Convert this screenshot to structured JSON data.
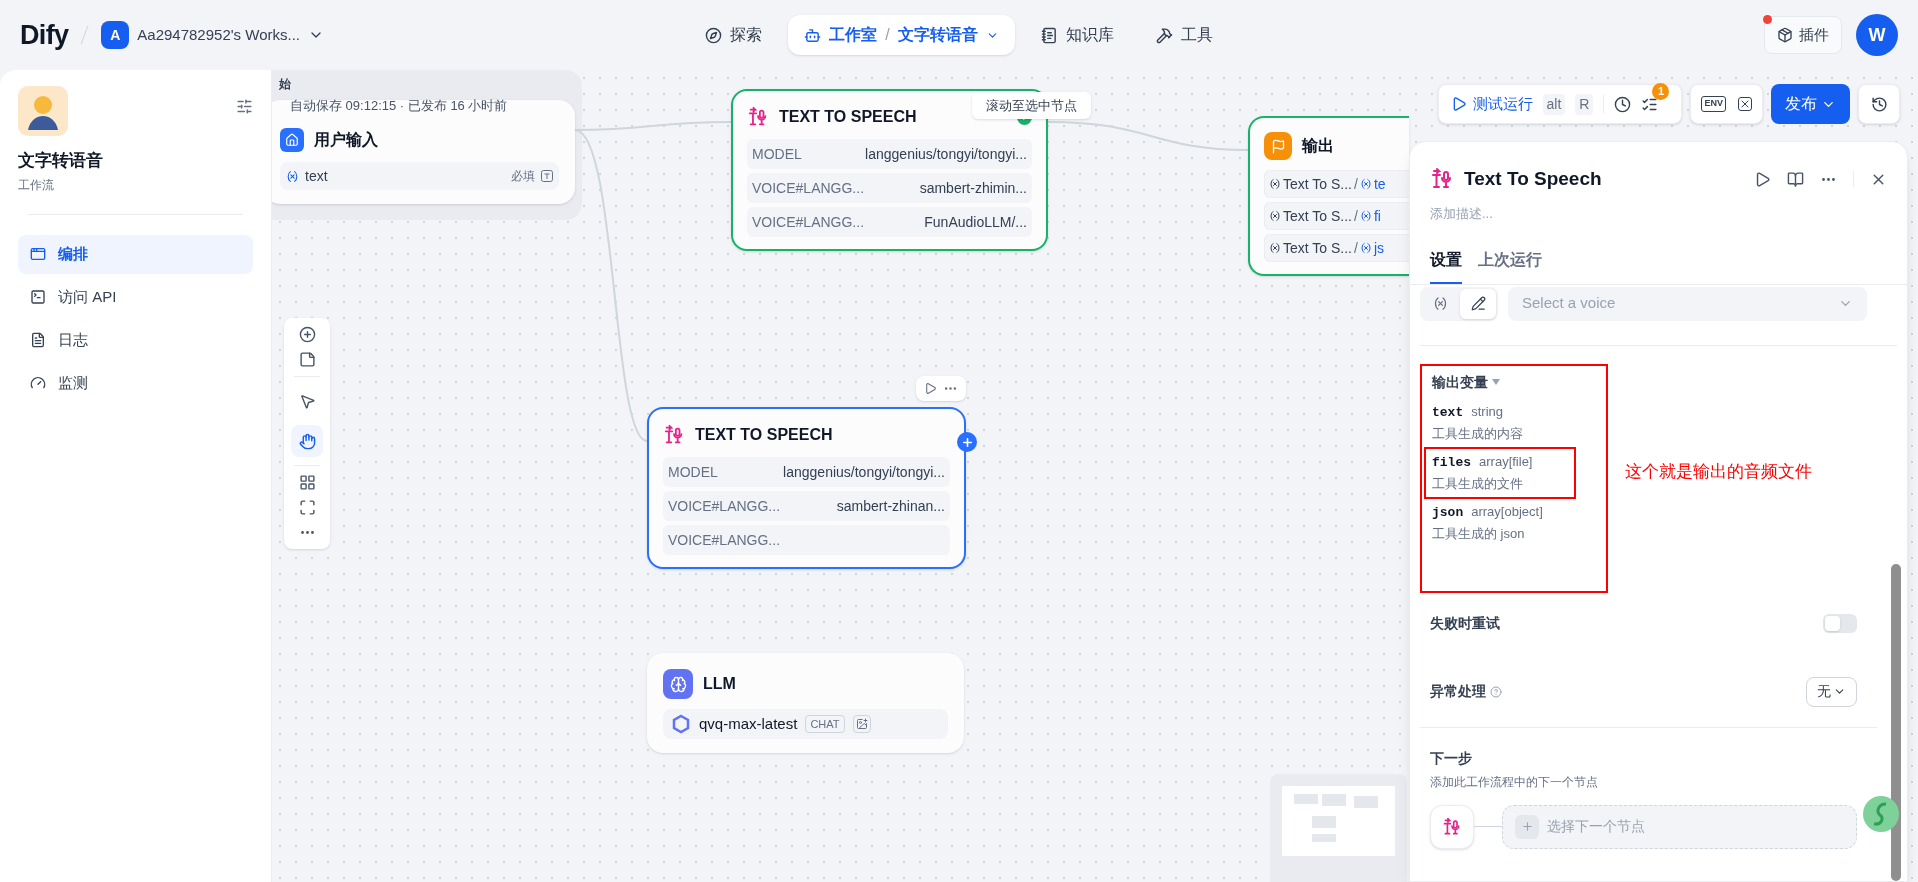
{
  "header": {
    "logo": "Dify",
    "workspace": {
      "initial": "A",
      "name": "Aa294782952's Works..."
    },
    "nav": [
      {
        "kind": "explore",
        "label": "探索",
        "selected": false
      },
      {
        "kind": "studio",
        "label": "工作室",
        "separator": "/",
        "app": "文字转语音",
        "selected": true
      },
      {
        "kind": "knowledge",
        "label": "知识库",
        "selected": false
      },
      {
        "kind": "tools",
        "label": "工具",
        "selected": false
      }
    ],
    "plugins": "插件",
    "avatar": "W"
  },
  "sidebar": {
    "app_name": "文字转语音",
    "app_type": "工作流",
    "items": [
      {
        "kind": "orchestrate",
        "label": "编排",
        "selected": true
      },
      {
        "kind": "api",
        "label": "访问 API",
        "selected": false
      },
      {
        "kind": "logs",
        "label": "日志",
        "selected": false
      },
      {
        "kind": "monitor",
        "label": "监测",
        "selected": false
      }
    ]
  },
  "canvas": {
    "autosave": "自动保存 09:12:15 · 已发布 16 小时前",
    "tooltip": "滚动至选中节点",
    "tools": [
      {
        "kind": "pointer",
        "selected": false
      },
      {
        "kind": "hand",
        "selected": true
      }
    ],
    "toolbar": {
      "test_run": "测试运行",
      "shortcut": [
        "alt",
        "R"
      ],
      "checklist_badge": "1",
      "env": "ENV",
      "publish": "发布"
    },
    "nodes": [
      {
        "kind": "start",
        "header": "始",
        "title": "用户输入",
        "selected": false,
        "succeeded": false,
        "variables": [
          {
            "name": "text",
            "required": "必填"
          }
        ]
      },
      {
        "kind": "tts",
        "title": "TEXT TO SPEECH",
        "selected": false,
        "succeeded": true,
        "rows": [
          {
            "label": "MODEL",
            "value": "langgenius/tongyi/tongyi..."
          },
          {
            "label": "VOICE#LANGG...",
            "value": "sambert-zhimin..."
          },
          {
            "label": "VOICE#LANGG...",
            "value": "FunAudioLLM/..."
          }
        ]
      },
      {
        "kind": "end",
        "title": "输出",
        "selected": false,
        "succeeded": true,
        "rows": [
          {
            "label": "Text To S...",
            "separator": "/",
            "value": "te"
          },
          {
            "label": "Text To S...",
            "separator": "/",
            "value": "fi"
          },
          {
            "label": "Text To S...",
            "separator": "/",
            "value": "js"
          }
        ]
      },
      {
        "kind": "tts",
        "title": "TEXT TO SPEECH",
        "selected": true,
        "succeeded": false,
        "rows": [
          {
            "label": "MODEL",
            "value": "langgenius/tongyi/tongyi..."
          },
          {
            "label": "VOICE#LANGG...",
            "value": "sambert-zhinan..."
          },
          {
            "label": "VOICE#LANGG..."
          }
        ]
      },
      {
        "kind": "llm",
        "title": "LLM",
        "selected": false,
        "succeeded": false,
        "model": "qvq-max-latest",
        "mode": "CHAT"
      }
    ]
  },
  "panel": {
    "title": "Text To Speech",
    "description_placeholder": "添加描述...",
    "tabs": [
      {
        "label": "设置",
        "selected": true
      },
      {
        "label": "上次运行",
        "selected": false
      }
    ],
    "voice_select": {
      "placeholder": "Select a voice",
      "input_modes": [
        {
          "kind": "variable",
          "selected": false
        },
        {
          "kind": "constant",
          "selected": true
        }
      ]
    },
    "outputs": {
      "title": "输出变量",
      "expanded": true,
      "vars": [
        {
          "name": "text",
          "type": "string",
          "description": "工具生成的内容",
          "highlighted": false
        },
        {
          "name": "files",
          "type": "array[file]",
          "description": "工具生成的文件",
          "highlighted": true
        },
        {
          "name": "json",
          "type": "array[object]",
          "description": "工具生成的 json",
          "highlighted": false
        }
      ]
    },
    "annotation": "这个就是输出的音频文件",
    "retry": {
      "label": "失败时重试",
      "on": false
    },
    "error_handling": {
      "label": "异常处理",
      "value": "无"
    },
    "next_step": {
      "title": "下一步",
      "subtitle": "添加此工作流程中的下一个节点",
      "placeholder": "选择下一个节点"
    }
  }
}
